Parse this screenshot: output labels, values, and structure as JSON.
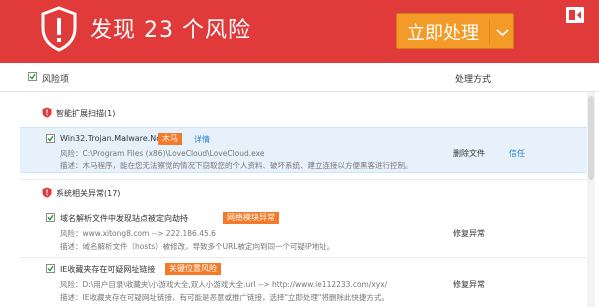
{
  "header": {
    "title": "发现 23 个风险",
    "action_button": "立即处理",
    "colors": {
      "header_bg": "#e03a3a",
      "button_bg": "#f49a29"
    }
  },
  "columns": {
    "risk": "风险项",
    "action": "处理方式"
  },
  "groups": [
    {
      "title": "智能扩展扫描(1)",
      "items": [
        {
          "name": "Win32.Trojan.Malware.Ncja",
          "tag": "木马",
          "link": "详情",
          "risk_line": "风险：C:\\Program Files (x86)\\LoveCloud\\LoveCloud.exe",
          "desc_line": "描述：木马程序，能在您无法察觉的情况下窃取您的个人资料、破坏系统、建立连接以方便黑客进行控制。",
          "action": "删除文件",
          "trust": "信任"
        }
      ]
    },
    {
      "title": "系统相关异常(17)",
      "items": [
        {
          "name": "域名解析文件中发现站点被定向劫持",
          "tag": "网络模块异常",
          "risk_line": "风险：www.xitong8.com --> 222.186.45.6",
          "desc_line": "描述：域名解析文件（hosts）被修改，导致多个URL被定向到同一个可疑IP地址。",
          "action": "修复异常"
        },
        {
          "name": "IE收藏夹存在可疑网址链接",
          "tag": "关键位置风险",
          "risk_line": "风险：D:\\用户目录\\收藏夹\\小游戏大全,双人小游戏大全.url --> http://www.ie112233.com/xyx/",
          "desc_line": "描述：IE收藏夹存在可疑网址链接，有可能是恶意或推广链接，选择\"立即处理\"将删除此快捷方式。",
          "action": "修复异常"
        }
      ]
    }
  ]
}
